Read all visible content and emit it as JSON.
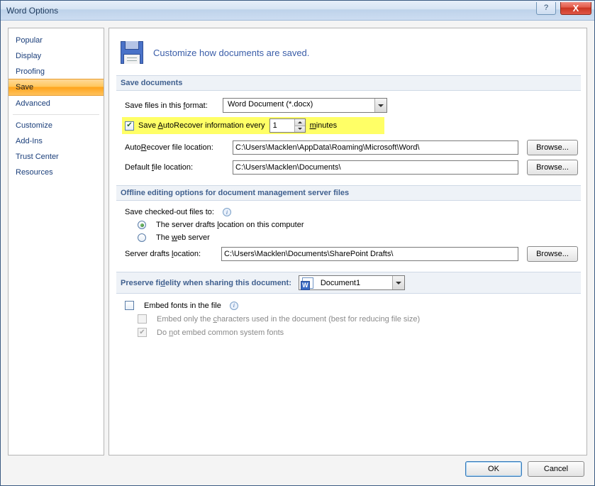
{
  "title": "Word Options",
  "winbuttons": {
    "help": "?",
    "close": "X"
  },
  "sidebar": {
    "items": [
      {
        "label": "Popular"
      },
      {
        "label": "Display"
      },
      {
        "label": "Proofing"
      },
      {
        "label": "Save"
      },
      {
        "label": "Advanced"
      },
      {
        "label": "Customize"
      },
      {
        "label": "Add-Ins"
      },
      {
        "label": "Trust Center"
      },
      {
        "label": "Resources"
      }
    ],
    "selected": "Save"
  },
  "heading": "Customize how documents are saved.",
  "sections": {
    "save_documents": {
      "title": "Save documents",
      "format_label": "Save files in this format:",
      "format_value": "Word Document (*.docx)",
      "autorecover_label_a": "Save ",
      "autorecover_label_b": "AutoRecover information every",
      "autorecover_value": "1",
      "minutes_label": "minutes",
      "autorecover_loc_label": "AutoRecover file location:",
      "autorecover_loc_value": "C:\\Users\\Macklen\\AppData\\Roaming\\Microsoft\\Word\\",
      "default_loc_label": "Default file location:",
      "default_loc_value": "C:\\Users\\Macklen\\Documents\\",
      "browse": "Browse..."
    },
    "offline": {
      "title": "Offline editing options for document management server files",
      "save_checked_label": "Save checked-out files to:",
      "opt_local": "The server drafts location on this computer",
      "opt_web": "The web server",
      "drafts_label": "Server drafts location:",
      "drafts_value": "C:\\Users\\Macklen\\Documents\\SharePoint Drafts\\",
      "browse": "Browse..."
    },
    "fidelity": {
      "title": "Preserve fidelity when sharing this document:",
      "doc_name": "Document1",
      "embed_fonts": "Embed fonts in the file",
      "embed_chars": "Embed only the characters used in the document (best for reducing file size)",
      "embed_skip_common": "Do not embed common system fonts"
    }
  },
  "footer": {
    "ok": "OK",
    "cancel": "Cancel"
  },
  "underlines": {
    "format_f": "f",
    "format_ormat": "ormat:",
    "auto_A": "A",
    "auto_rest": "utoRecover information every",
    "min_m": "m",
    "min_rest": "inutes",
    "autor_R": "R",
    "autor_pre": "Auto",
    "autor_rest": "ecover file location:",
    "def_f": "f",
    "def_pre": "Default ",
    "def_rest": "ile location:",
    "local_l": "l",
    "local_pre": "The server drafts ",
    "local_rest": "ocation on this computer",
    "web_w": "w",
    "web_pre": "The ",
    "web_rest": "eb server",
    "drafts_l": "l",
    "drafts_pre": "Server drafts ",
    "drafts_rest": "ocation:",
    "fid_d": "d",
    "fid_pre": "Preserve fi",
    "fid_rest": "elity when sharing this document:",
    "embed_c": "c",
    "embed_pre": "Embed only the ",
    "embed_rest": "haracters used in the document (best for reducing file size)",
    "common_n": "n",
    "common_pre": "Do ",
    "common_rest": "ot embed common system fonts"
  }
}
